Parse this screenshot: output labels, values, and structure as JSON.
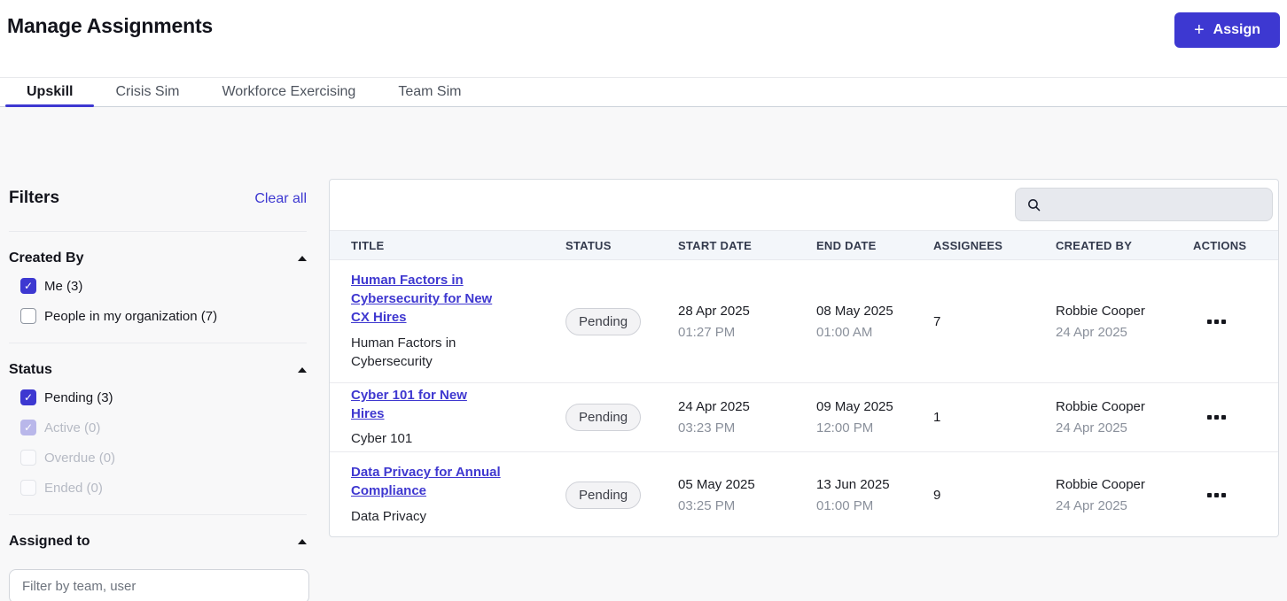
{
  "header": {
    "title": "Manage Assignments",
    "assign_button": {
      "plus": "+",
      "label": "Assign"
    }
  },
  "tabs": [
    {
      "label": "Upskill",
      "active": true
    },
    {
      "label": "Crisis Sim",
      "active": false
    },
    {
      "label": "Workforce Exercising",
      "active": false
    },
    {
      "label": "Team Sim",
      "active": false
    }
  ],
  "filters": {
    "heading": "Filters",
    "clear_all": "Clear all",
    "sections": [
      {
        "title": "Created By",
        "options": [
          {
            "label": "Me (3)",
            "checked": true,
            "disabled": false
          },
          {
            "label": "People in my organization (7)",
            "checked": false,
            "disabled": false
          }
        ]
      },
      {
        "title": "Status",
        "options": [
          {
            "label": "Pending (3)",
            "checked": true,
            "disabled": false
          },
          {
            "label": "Active (0)",
            "checked": true,
            "disabled": true
          },
          {
            "label": "Overdue (0)",
            "checked": false,
            "disabled": true
          },
          {
            "label": "Ended (0)",
            "checked": false,
            "disabled": true
          }
        ]
      },
      {
        "title": "Assigned to",
        "input_placeholder": "Filter by team, user"
      }
    ]
  },
  "table": {
    "columns": [
      "TITLE",
      "STATUS",
      "START DATE",
      "END DATE",
      "ASSIGNEES",
      "CREATED BY",
      "ACTIONS"
    ],
    "rows": [
      {
        "title": "Human Factors in Cybersecurity for New CX Hires",
        "subtitle": "Human Factors in Cybersecurity",
        "status": "Pending",
        "start_date": "28 Apr 2025",
        "start_time": "01:27 PM",
        "end_date": "08 May 2025",
        "end_time": "01:00 AM",
        "assignees": "7",
        "created_by": "Robbie Cooper",
        "created_date": "24 Apr 2025"
      },
      {
        "title": "Cyber 101 for New Hires",
        "subtitle": "Cyber 101",
        "status": "Pending",
        "start_date": "24 Apr 2025",
        "start_time": "03:23 PM",
        "end_date": "09 May 2025",
        "end_time": "12:00 PM",
        "assignees": "1",
        "created_by": "Robbie Cooper",
        "created_date": "24 Apr 2025"
      },
      {
        "title": "Data Privacy for Annual Compliance",
        "subtitle": "Data Privacy",
        "status": "Pending",
        "start_date": "05 May 2025",
        "start_time": "03:25 PM",
        "end_date": "13 Jun 2025",
        "end_time": "01:00 PM",
        "assignees": "9",
        "created_by": "Robbie Cooper",
        "created_date": "24 Apr 2025"
      }
    ]
  },
  "icons": {
    "assign": "plus-icon",
    "search": "magnifier-icon",
    "section_toggle": "caret-up-icon",
    "row_actions": "ellipsis-icon"
  },
  "colors": {
    "accent": "#3d38d1"
  }
}
